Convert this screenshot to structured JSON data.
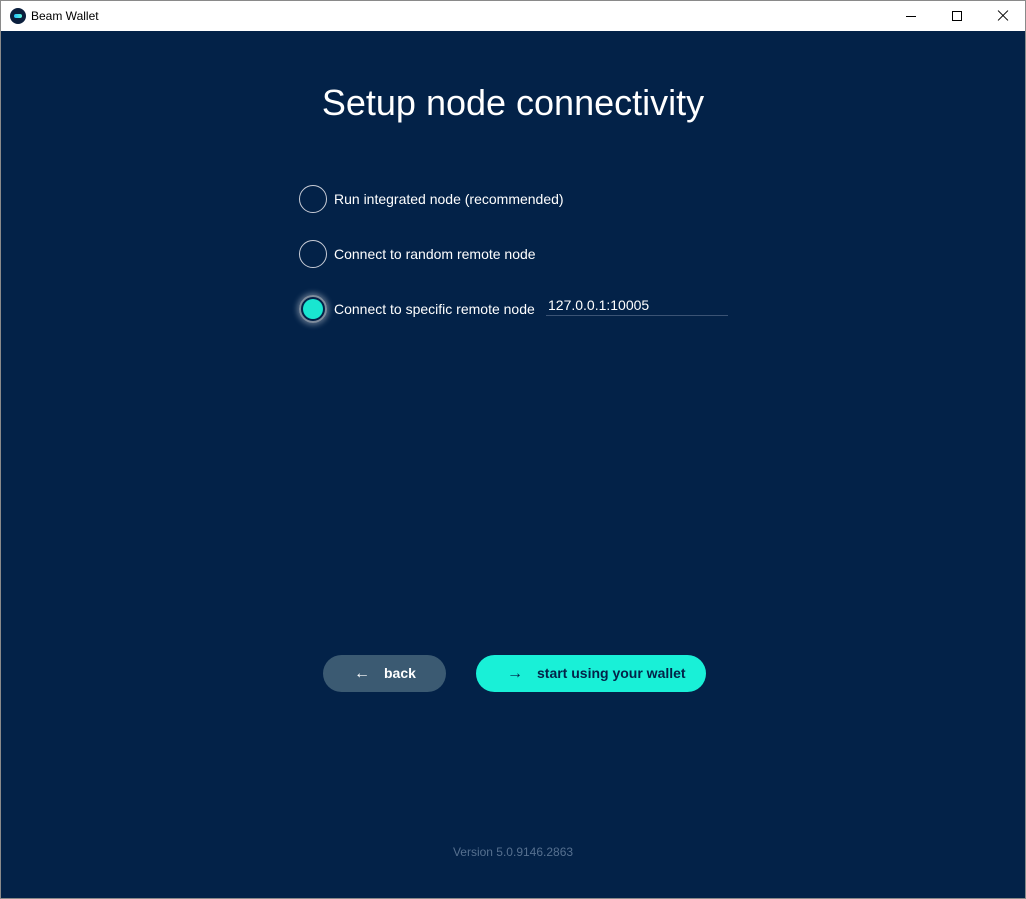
{
  "window": {
    "title": "Beam Wallet",
    "icon": "beam-logo-icon"
  },
  "page": {
    "title": "Setup node connectivity"
  },
  "options": [
    {
      "label": "Run integrated node (recommended)",
      "selected": false
    },
    {
      "label": "Connect to random remote node",
      "selected": false
    },
    {
      "label": "Connect to specific remote node",
      "selected": true
    }
  ],
  "node_address": {
    "value": "127.0.0.1:10005"
  },
  "buttons": {
    "back_label": "back",
    "start_label": "start using your wallet",
    "back_icon": "arrow-left-icon",
    "start_icon": "arrow-right-icon"
  },
  "footer": {
    "version": "Version 5.0.9146.2863"
  },
  "colors": {
    "background": "#032248",
    "accent": "#19f0d7",
    "back_button": "#3b5a72"
  }
}
